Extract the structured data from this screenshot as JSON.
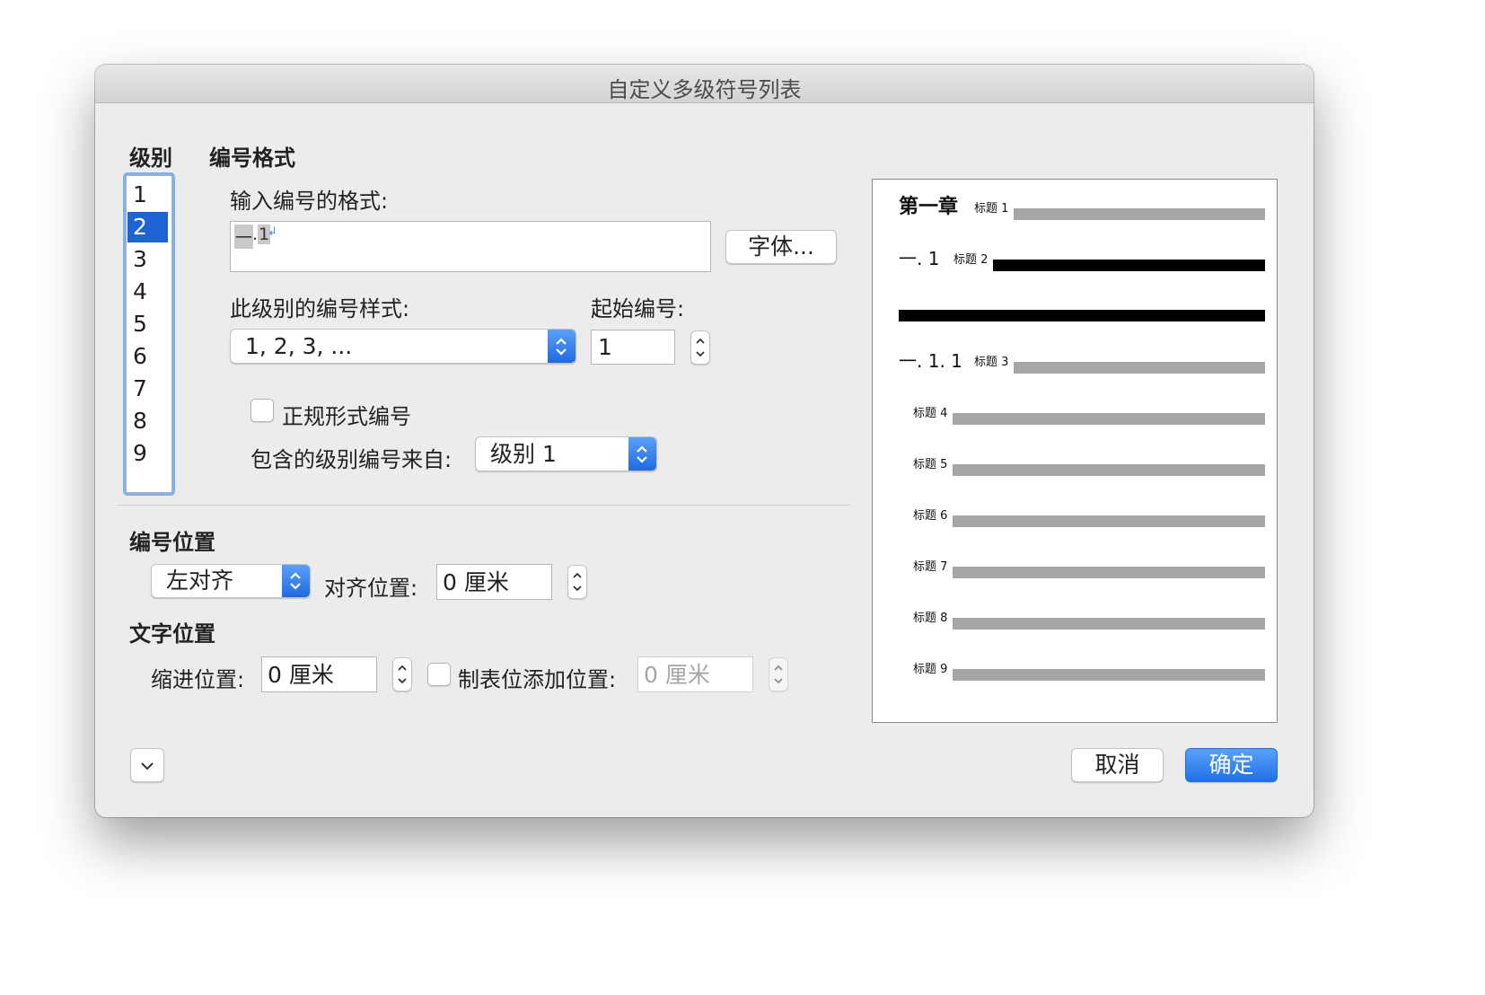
{
  "dialog": {
    "title": "自定义多级符号列表"
  },
  "sections": {
    "level": "级别",
    "number_format": "编号格式",
    "number_position": "编号位置",
    "text_position": "文字位置"
  },
  "levels": [
    "1",
    "2",
    "3",
    "4",
    "5",
    "6",
    "7",
    "8",
    "9"
  ],
  "selected_level": "2",
  "format": {
    "enter_label": "输入编号的格式:",
    "value_part1": "一",
    "value_sep": ".",
    "value_part2": "1",
    "return_mark": "↲",
    "font_button": "字体...",
    "style_label": "此级别的编号样式:",
    "style_value": "1, 2, 3, ...",
    "start_label": "起始编号:",
    "start_value": "1",
    "legal_label": "正规形式编号",
    "legal_checked": false,
    "include_label": "包含的级别编号来自:",
    "include_value": "级别 1"
  },
  "number_position": {
    "align_value": "左对齐",
    "align_at_label": "对齐位置:",
    "align_at_value": "0 厘米"
  },
  "text_position": {
    "indent_label": "缩进位置:",
    "indent_value": "0 厘米",
    "tab_label": "制表位添加位置:",
    "tab_checked": false,
    "tab_value": "0 厘米"
  },
  "preview": {
    "chapter": "第一章",
    "heading1": "标题 1",
    "num2": "一. 1",
    "heading2": "标题 2",
    "num3": "一. 1. 1",
    "heading3": "标题 3",
    "heading4": "标题 4",
    "heading5": "标题 5",
    "heading6": "标题 6",
    "heading7": "标题 7",
    "heading8": "标题 8",
    "heading9": "标题 9"
  },
  "buttons": {
    "cancel": "取消",
    "ok": "确定"
  },
  "colors": {
    "accent": "#1d63d6",
    "ok_button": "#2a7ef1"
  }
}
